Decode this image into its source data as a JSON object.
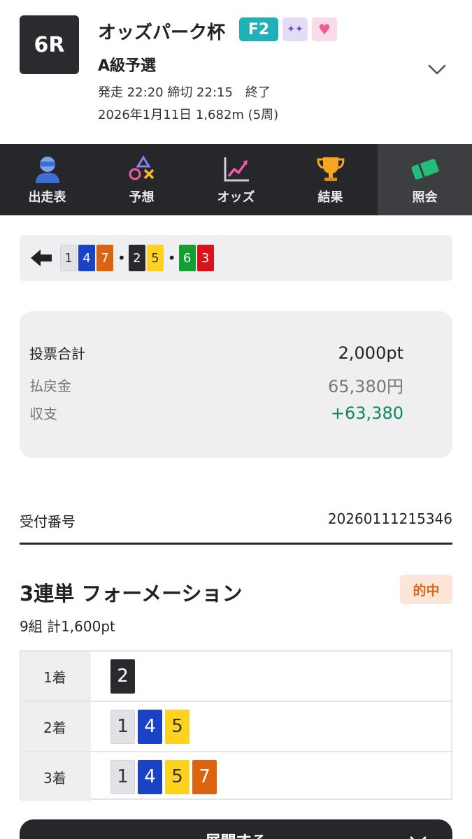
{
  "race": {
    "number": "6R",
    "title": "オッズパーク杯",
    "grade": "F2",
    "class": "A級予選",
    "times": "発走 22:20 締切 22:15　終了",
    "date_info": "2026年1月11日 1,682m (5周)"
  },
  "nav": {
    "items": [
      {
        "label": "出走表",
        "icon": "rider-icon"
      },
      {
        "label": "予想",
        "icon": "prediction-icon"
      },
      {
        "label": "オッズ",
        "icon": "odds-chart-icon"
      },
      {
        "label": "結果",
        "icon": "trophy-icon"
      },
      {
        "label": "照会",
        "icon": "ticket-icon",
        "active": true
      }
    ]
  },
  "combination": {
    "group1": [
      "1",
      "4",
      "7"
    ],
    "group2": [
      "2",
      "5"
    ],
    "group3": [
      "6",
      "3"
    ]
  },
  "summary": {
    "total_label": "投票合計",
    "total_value": "2,000pt",
    "payout_label": "払戻金",
    "payout_value": "65,380円",
    "balance_label": "収支",
    "balance_value": "+63,380"
  },
  "receipt": {
    "label": "受付番号",
    "value": "20260111215346"
  },
  "bet": {
    "type": "3連単 フォーメーション",
    "status": "的中",
    "count": "9組 計1,600pt"
  },
  "formation": {
    "rows": [
      {
        "label": "1着",
        "numbers": [
          "2"
        ]
      },
      {
        "label": "2着",
        "numbers": [
          "1",
          "4",
          "5"
        ]
      },
      {
        "label": "3着",
        "numbers": [
          "1",
          "4",
          "5",
          "7"
        ]
      }
    ]
  },
  "colors": {
    "1": "#e2e2e6",
    "2": "#2a2a2e",
    "3": "#d9121e",
    "4": "#1a42c4",
    "5": "#ffd21f",
    "6": "#12a030",
    "7": "#dc6410",
    "balance_positive": "#0d8a5c",
    "muted_text": "#777777",
    "hit_badge": "#d96a1a"
  },
  "expand_button": {
    "label": "展開する"
  }
}
